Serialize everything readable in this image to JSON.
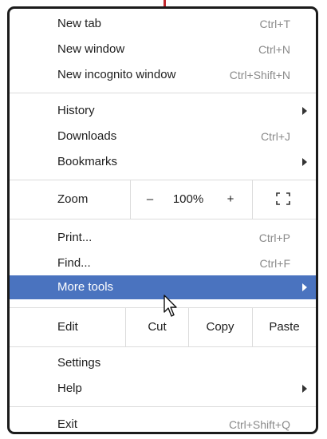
{
  "menu": {
    "new_tab": {
      "label": "New tab",
      "shortcut": "Ctrl+T"
    },
    "new_window": {
      "label": "New window",
      "shortcut": "Ctrl+N"
    },
    "new_incognito": {
      "label": "New incognito window",
      "shortcut": "Ctrl+Shift+N"
    },
    "history": {
      "label": "History"
    },
    "downloads": {
      "label": "Downloads",
      "shortcut": "Ctrl+J"
    },
    "bookmarks": {
      "label": "Bookmarks"
    },
    "zoom": {
      "label": "Zoom",
      "minus": "–",
      "level": "100%",
      "plus": "+"
    },
    "print": {
      "label": "Print...",
      "shortcut": "Ctrl+P"
    },
    "find": {
      "label": "Find...",
      "shortcut": "Ctrl+F"
    },
    "more_tools": {
      "label": "More tools"
    },
    "edit": {
      "label": "Edit",
      "cut": "Cut",
      "copy": "Copy",
      "paste": "Paste"
    },
    "settings": {
      "label": "Settings"
    },
    "help": {
      "label": "Help"
    },
    "exit": {
      "label": "Exit",
      "shortcut": "Ctrl+Shift+Q"
    }
  },
  "icons": {
    "fullscreen": "fullscreen-icon",
    "submenu_arrow": "chevron-right-icon",
    "cursor": "mouse-pointer-icon"
  },
  "colors": {
    "highlight": "#4a73bf",
    "border": "#1b1b1b",
    "shortcut_text": "#8a8a8a",
    "accent_mark": "#c2272d"
  }
}
